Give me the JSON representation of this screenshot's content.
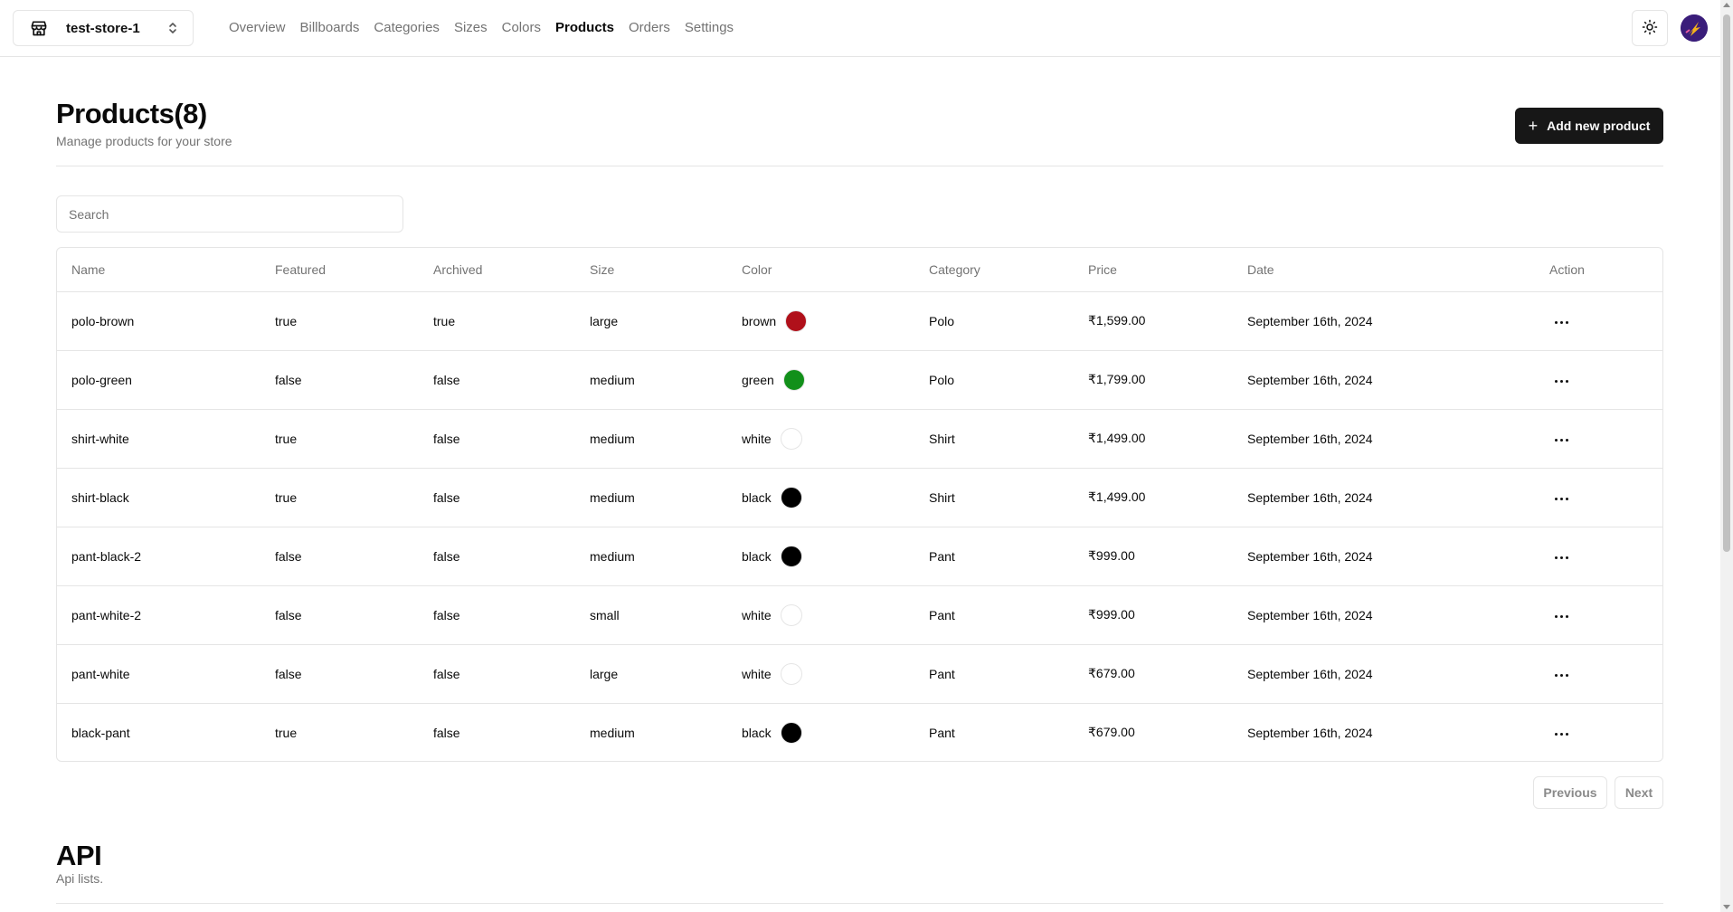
{
  "store": {
    "name": "test-store-1",
    "icon": "store-icon"
  },
  "nav": [
    {
      "label": "Overview",
      "active": false
    },
    {
      "label": "Billboards",
      "active": false
    },
    {
      "label": "Categories",
      "active": false
    },
    {
      "label": "Sizes",
      "active": false
    },
    {
      "label": "Colors",
      "active": false
    },
    {
      "label": "Products",
      "active": true
    },
    {
      "label": "Orders",
      "active": false
    },
    {
      "label": "Settings",
      "active": false
    }
  ],
  "header": {
    "title": "Products(8)",
    "subtitle": "Manage products for your store",
    "add_button": "Add new product"
  },
  "search": {
    "placeholder": "Search",
    "value": ""
  },
  "table": {
    "columns": [
      "Name",
      "Featured",
      "Archived",
      "Size",
      "Color",
      "Category",
      "Price",
      "Date",
      "Action"
    ],
    "rows": [
      {
        "name": "polo-brown",
        "featured": "true",
        "archived": "true",
        "size": "large",
        "color": "brown",
        "color_hex": "#b0101a",
        "category": "Polo",
        "price": "₹1,599.00",
        "date": "September 16th, 2024"
      },
      {
        "name": "polo-green",
        "featured": "false",
        "archived": "false",
        "size": "medium",
        "color": "green",
        "color_hex": "#12901a",
        "category": "Polo",
        "price": "₹1,799.00",
        "date": "September 16th, 2024"
      },
      {
        "name": "shirt-white",
        "featured": "true",
        "archived": "false",
        "size": "medium",
        "color": "white",
        "color_hex": "#ffffff",
        "category": "Shirt",
        "price": "₹1,499.00",
        "date": "September 16th, 2024"
      },
      {
        "name": "shirt-black",
        "featured": "true",
        "archived": "false",
        "size": "medium",
        "color": "black",
        "color_hex": "#000000",
        "category": "Shirt",
        "price": "₹1,499.00",
        "date": "September 16th, 2024"
      },
      {
        "name": "pant-black-2",
        "featured": "false",
        "archived": "false",
        "size": "medium",
        "color": "black",
        "color_hex": "#000000",
        "category": "Pant",
        "price": "₹999.00",
        "date": "September 16th, 2024"
      },
      {
        "name": "pant-white-2",
        "featured": "false",
        "archived": "false",
        "size": "small",
        "color": "white",
        "color_hex": "#ffffff",
        "category": "Pant",
        "price": "₹999.00",
        "date": "September 16th, 2024"
      },
      {
        "name": "pant-white",
        "featured": "false",
        "archived": "false",
        "size": "large",
        "color": "white",
        "color_hex": "#ffffff",
        "category": "Pant",
        "price": "₹679.00",
        "date": "September 16th, 2024"
      },
      {
        "name": "black-pant",
        "featured": "true",
        "archived": "false",
        "size": "medium",
        "color": "black",
        "color_hex": "#000000",
        "category": "Pant",
        "price": "₹679.00",
        "date": "September 16th, 2024"
      }
    ]
  },
  "pagination": {
    "previous": "Previous",
    "next": "Next"
  },
  "api": {
    "title": "API",
    "subtitle": "Api lists."
  },
  "theme": {
    "accent": "#171717",
    "muted": "#737373",
    "border": "#e5e5e5"
  }
}
